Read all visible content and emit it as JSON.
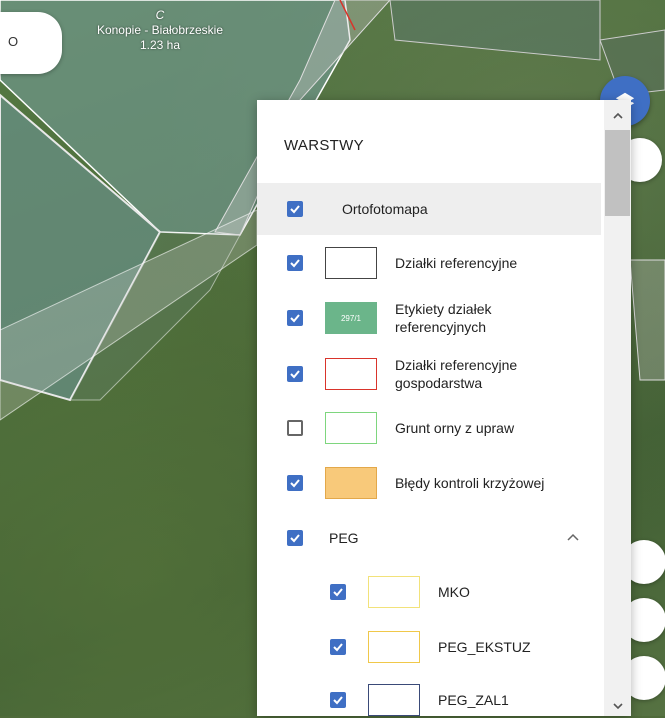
{
  "map": {
    "parcel_label": {
      "name": "Konopie - Białobrzeskie",
      "area": "1.23 ha",
      "marker": "C"
    },
    "search_text": "O"
  },
  "panel": {
    "title": "WARSTWY",
    "layers": [
      {
        "label": "Ortofotomapa",
        "checked": true
      },
      {
        "label": "Działki referencyjne",
        "checked": true,
        "swatch": "#444444"
      },
      {
        "label": "Etykiety działek referencyjnych",
        "checked": true,
        "swatch_text": "297/1",
        "swatch": "#6bb58a"
      },
      {
        "label": "Działki referencyjne gospodarstwa",
        "checked": true,
        "swatch": "#d9342b"
      },
      {
        "label": "Grunt orny z upraw",
        "checked": false,
        "swatch": "#7ed67e"
      },
      {
        "label": "Błędy kontroli krzyżowej",
        "checked": true,
        "swatch": "#f8c97a"
      },
      {
        "label": "PEG",
        "checked": true
      },
      {
        "label": "MKO",
        "checked": true,
        "swatch": "#f2e27a"
      },
      {
        "label": "PEG_EKSTUZ",
        "checked": true,
        "swatch": "#f0c84a"
      },
      {
        "label": "PEG_ZAL1",
        "checked": true,
        "swatch": "#3a4a78"
      }
    ]
  },
  "icons": {
    "layers": "layers-icon",
    "chevron_up": "chevron-up-icon",
    "checkmark": "check-icon"
  },
  "colors": {
    "accent": "#3f6fc4"
  }
}
